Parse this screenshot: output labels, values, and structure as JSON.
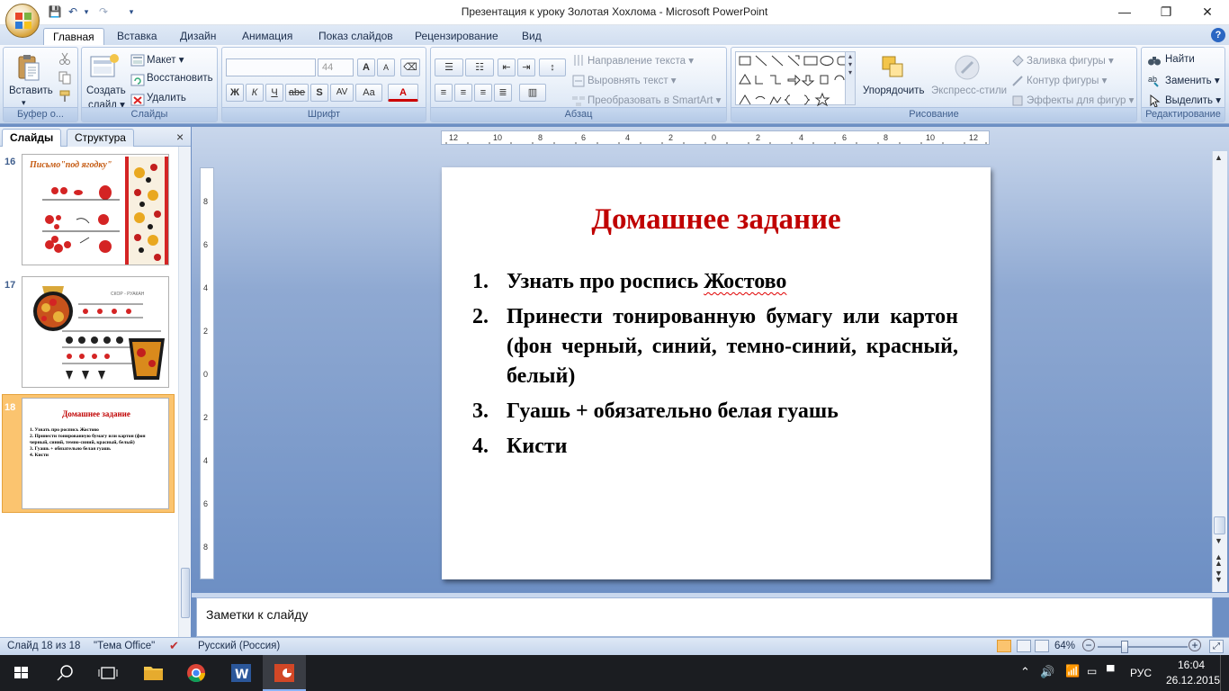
{
  "window": {
    "title": "Презентация к уроку Золотая Хохлома - Microsoft PowerPoint",
    "minimize": "—",
    "restore": "❐",
    "close": "✕"
  },
  "quick_access": {
    "save": "💾",
    "undo": "↶",
    "redo": "↷",
    "more": "▾"
  },
  "ribbon_tabs": [
    "Главная",
    "Вставка",
    "Дизайн",
    "Анимация",
    "Показ слайдов",
    "Рецензирование",
    "Вид"
  ],
  "help": "?",
  "groups": {
    "clipboard": {
      "label": "Буфер о...",
      "paste": "Вставить"
    },
    "slides": {
      "label": "Слайды",
      "create": "Создать",
      "create2": "слайд ▾",
      "layout": "Макет ▾",
      "reset": "Восстановить",
      "delete": "Удалить"
    },
    "font": {
      "label": "Шрифт",
      "font_name": "",
      "font_size": "44",
      "grow": "A",
      "shrink": "A",
      "bold": "Ж",
      "italic": "К",
      "underline": "Ч",
      "strike": "abe",
      "shadow": "S",
      "spacing": "AV",
      "case": "Aa",
      "color": "A"
    },
    "paragraph": {
      "label": "Абзац",
      "text_direction": "Направление текста ▾",
      "align_text": "Выровнять текст ▾",
      "smartart": "Преобразовать в SmartArt ▾"
    },
    "drawing": {
      "label": "Рисование",
      "arrange": "Упорядочить",
      "quick_styles": "Экспресс-стили",
      "fill": "Заливка фигуры ▾",
      "outline": "Контур фигуры ▾",
      "effects": "Эффекты для фигур ▾"
    },
    "editing": {
      "label": "Редактирование",
      "find": "Найти",
      "replace": "Заменить ▾",
      "select": "Выделить ▾"
    }
  },
  "panel": {
    "tab_slides": "Слайды",
    "tab_outline": "Структура",
    "close": "×",
    "thumbs": [
      {
        "num": "16",
        "title": "Письмо\"под ягодку\""
      },
      {
        "num": "17",
        "title": "СКОР - РУАКАН"
      },
      {
        "num": "18",
        "title": "Домашнее задание"
      }
    ]
  },
  "ruler_h_labels": [
    "12",
    "10",
    "8",
    "6",
    "4",
    "2",
    "0",
    "2",
    "4",
    "6",
    "8",
    "10",
    "12"
  ],
  "ruler_v_labels": [
    "8",
    "6",
    "4",
    "2",
    "0",
    "2",
    "4",
    "6",
    "8"
  ],
  "slide": {
    "title": "Домашнее задание",
    "items": [
      {
        "n": "1.",
        "pre": "Узнать про роспись ",
        "err": "Жостово",
        "post": ""
      },
      {
        "n": "2.",
        "pre": "Принести тонированную бумагу или картон (фон черный, синий, темно-синий, красный, белый)",
        "err": "",
        "post": ""
      },
      {
        "n": "3.",
        "pre": "Гуашь + обязательно белая гуашь",
        "err": "",
        "post": ""
      },
      {
        "n": "4.",
        "pre": "Кисти",
        "err": "",
        "post": ""
      }
    ]
  },
  "notes": {
    "placeholder": "Заметки к слайду"
  },
  "status": {
    "slide_counter": "Слайд 18 из 18",
    "theme": "\"Тема Office\"",
    "language": "Русский (Россия)",
    "zoom": "64%",
    "minus": "−",
    "plus": "+"
  },
  "taskbar": {
    "lang": "РУС",
    "time": "16:04",
    "date": "26.12.2015"
  }
}
